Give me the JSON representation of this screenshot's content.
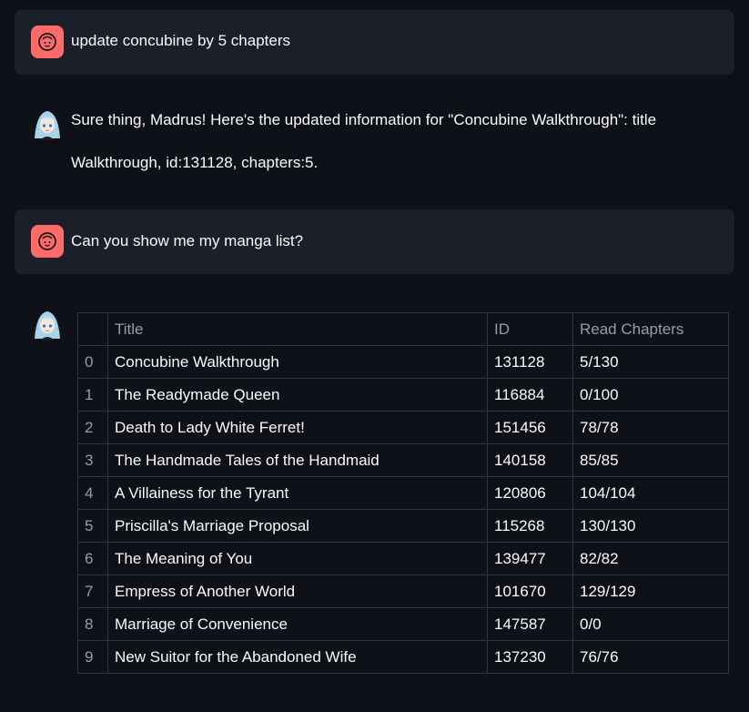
{
  "messages": [
    {
      "role": "user",
      "text": "update concubine by 5 chapters"
    },
    {
      "role": "assistant",
      "lines": [
        "Sure thing, Madrus! Here's the updated information for \"Concubine Walkthrough\": title",
        "Walkthrough, id:131128, chapters:5."
      ]
    },
    {
      "role": "user",
      "text": "Can you show me my manga list?"
    }
  ],
  "table": {
    "headers": [
      "",
      "Title",
      "ID",
      "Read Chapters"
    ],
    "rows": [
      [
        "0",
        "Concubine Walkthrough",
        "131128",
        "5/130"
      ],
      [
        "1",
        "The Readymade Queen",
        "116884",
        "0/100"
      ],
      [
        "2",
        "Death to Lady White Ferret!",
        "151456",
        "78/78"
      ],
      [
        "3",
        "The Handmade Tales of the Handmaid",
        "140158",
        "85/85"
      ],
      [
        "4",
        "A Villainess for the Tyrant",
        "120806",
        "104/104"
      ],
      [
        "5",
        "Priscilla's Marriage Proposal",
        "115268",
        "130/130"
      ],
      [
        "6",
        "The Meaning of You",
        "139477",
        "82/82"
      ],
      [
        "7",
        "Empress of Another World",
        "101670",
        "129/129"
      ],
      [
        "8",
        "Marriage of Convenience",
        "147587",
        "0/0"
      ],
      [
        "9",
        "New Suitor for the Abandoned Wife",
        "137230",
        "76/76"
      ]
    ]
  },
  "colors": {
    "background": "#0e1117",
    "user_bubble": "#1b1f29",
    "user_avatar": "#ff6b6b",
    "table_border": "#31343c",
    "muted_text": "#9a9ca3"
  },
  "icons": {
    "user_avatar": "user-face-icon",
    "assistant_avatar": "anime-girl-avatar-icon"
  }
}
